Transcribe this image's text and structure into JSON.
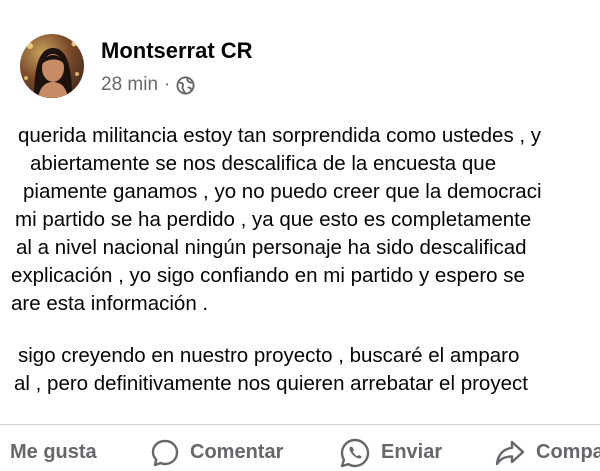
{
  "post": {
    "author": "Montserrat CR",
    "time": "28 min",
    "separator": "·",
    "privacy_icon": "globe-icon",
    "lines": [
      "querida militancia estoy tan sorprendida como ustedes , y",
      "abiertamente se nos descalifica de la encuesta que",
      "piamente ganamos , yo no puedo creer que la democraci",
      "mi partido se ha perdido , ya que esto es completamente",
      "al a nivel nacional ningún personaje ha sido descalificad",
      "explicación , yo sigo confiando en mi partido y espero se",
      "are esta información .",
      "sigo creyendo en nuestro proyecto , buscaré el amparo",
      "al , pero definitivamente nos quieren arrebatar el proyect"
    ]
  },
  "actions": {
    "like": "Me gusta",
    "comment": "Comentar",
    "send": "Enviar",
    "share": "Compa"
  },
  "icons": [
    "like-icon",
    "comment-icon",
    "whatsapp-icon",
    "share-icon"
  ],
  "colors": {
    "text": "#050505",
    "secondary": "#65676b",
    "divider": "#ced0d4"
  }
}
